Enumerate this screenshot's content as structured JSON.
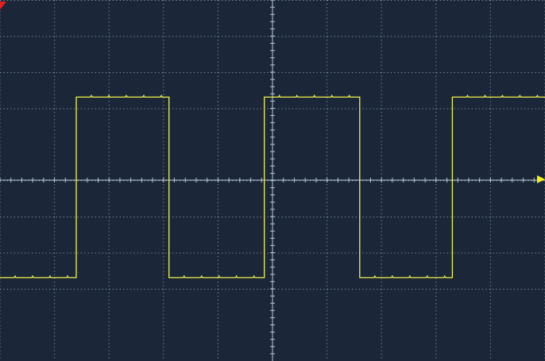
{
  "scope": {
    "colors": {
      "background": "#1b2739",
      "grid": "#8fa3b8",
      "center_axis": "#b9c8d8",
      "trace": "#f2f24a",
      "trigger_marker": "#e81e1e",
      "level_marker": "#f2f21a"
    },
    "grid": {
      "horizontal_divisions": 10,
      "vertical_divisions": 8,
      "subdivisions": 5
    },
    "markers": {
      "trigger_icon": "trigger-position-arrow-icon",
      "level_icon": "trigger-level-arrow-icon"
    },
    "waveform": {
      "type": "square",
      "high_level_div": 2.3,
      "low_level_div": -2.7,
      "transitions_div": [
        -3.6,
        -1.9,
        -0.15,
        1.6,
        3.3
      ]
    }
  }
}
